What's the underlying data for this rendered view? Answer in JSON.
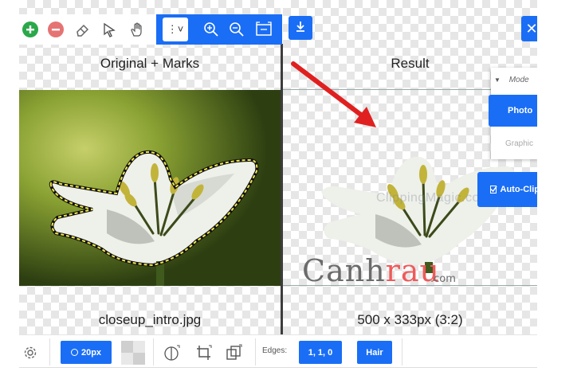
{
  "left_pane": {
    "title": "Original + Marks",
    "caption": "closeup_intro.jpg"
  },
  "right_pane": {
    "title": "Result",
    "caption": "500 x 333px (3:2)"
  },
  "toolbar": {
    "add_icon": "plus-circle-icon",
    "remove_icon": "minus-circle-icon",
    "eraser_icon": "eraser-icon",
    "select_icon": "arrow-pointer-icon",
    "pan_icon": "hand-icon",
    "view_select_label": "⋮˅",
    "zoom_in_icon": "zoom-in-icon",
    "zoom_out_icon": "zoom-out-icon",
    "fit_icon": "fit-screen-icon",
    "download_icon": "download-icon",
    "close_label": "✕"
  },
  "mode_panel": {
    "label": "Mode",
    "photo_label": "Photo",
    "graphic_label": "Graphic",
    "autoclip_label": "Auto-Clip"
  },
  "bottom_bar": {
    "settings_icon": "gear-icon",
    "brush_size_label": "20px",
    "background_icon": "checkerboard-icon",
    "shadow_icon": "half-circle-icon",
    "crop_icon": "crop-icon",
    "layer_icon": "layers-icon",
    "edges_label": "Edges:",
    "edges_value": "1, 1, 0",
    "hair_label": "Hair"
  },
  "watermark": {
    "text_a": "Canh",
    "text_b": "rau",
    "suffix": ".com",
    "overlay": "ClippingMagic.com"
  },
  "colors": {
    "accent": "#1a6ef5",
    "add": "#2ba84a",
    "remove": "#e57373",
    "arrow": "#e02020",
    "marks": "#f2e84a"
  }
}
